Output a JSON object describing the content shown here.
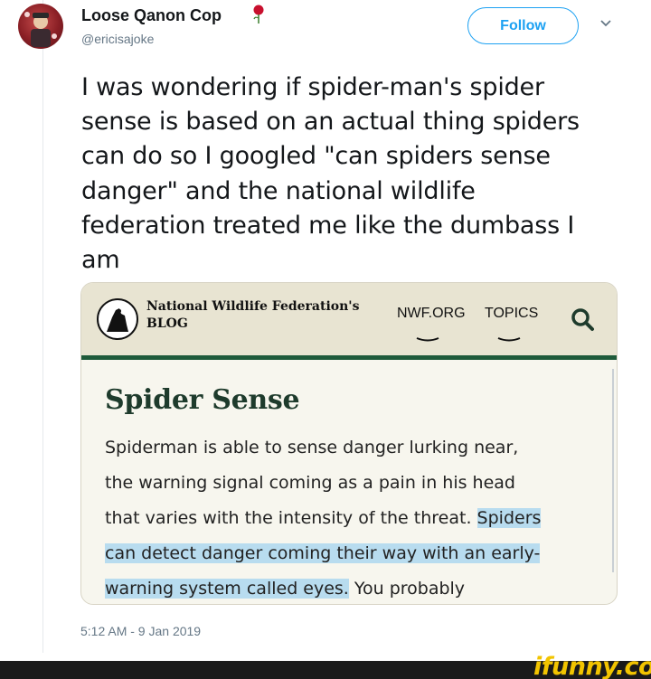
{
  "tweet": {
    "display_name": "Loose Qanon Cop",
    "handle": "@ericisajoke",
    "follow_label": "Follow",
    "text_lines": [
      "I was wondering if spider-man's spider",
      "sense is based on an actual thing spiders",
      "can do so I googled \"can spiders sense",
      "danger\" and the national wildlife",
      "federation treated me like the dumbass I",
      "am"
    ],
    "timestamp": "5:12 AM - 9 Jan 2019"
  },
  "embedded_page": {
    "blog_title_line1": "National Wildlife Federation's",
    "blog_title_line2": "BLOG",
    "nav": [
      "NWF.ORG",
      "TOPICS"
    ],
    "article_title": "Spider Sense",
    "body": {
      "line1": "Spiderman is able to sense danger lurking near,",
      "line2": "the warning signal coming as a pain in his head",
      "line3_plain": "that varies with the intensity of the threat. ",
      "line3_highlight": "Spiders",
      "line4_highlight": "can detect danger coming their way with an early-",
      "line5_highlight": "warning system called eyes.",
      "line5_plain": " You probably"
    },
    "colors": {
      "header_bg": "#e8e4d2",
      "rule": "#1e5a3a",
      "highlight": "#b8dcef",
      "title": "#1e3b2c"
    }
  },
  "watermark": "ifunny.co",
  "colors": {
    "accent": "#1da1f2",
    "muted": "#657786"
  }
}
